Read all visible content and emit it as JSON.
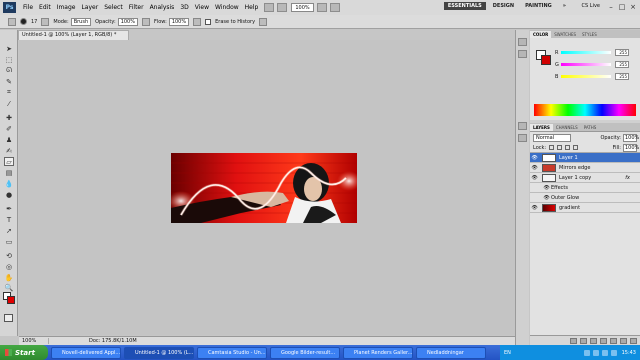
{
  "menubar": {
    "items": [
      "File",
      "Edit",
      "Image",
      "Layer",
      "Select",
      "Filter",
      "Analysis",
      "3D",
      "View",
      "Window",
      "Help"
    ],
    "zoom": "100%",
    "workspaces": [
      "ESSENTIALS",
      "DESIGN",
      "PAINTING"
    ],
    "more": "»",
    "cs_live": "CS Live",
    "window_controls": [
      "–",
      "□",
      "×"
    ]
  },
  "options_bar": {
    "brush_size": "17",
    "mode_label": "Mode:",
    "mode_value": "Brush",
    "opacity_label": "Opacity:",
    "opacity_value": "100%",
    "flow_label": "Flow:",
    "flow_value": "100%",
    "erase_history": "Erase to History"
  },
  "document": {
    "tab_title": "Untitled-1 @ 100% (Layer 1, RGB/8) *",
    "status_zoom": "100%",
    "status_doc": "Doc: 175.8K/1.10M"
  },
  "color_panel": {
    "tabs": [
      "COLOR",
      "SWATCHES",
      "STYLES"
    ],
    "channels": [
      {
        "label": "R",
        "value": "255",
        "gradient": "linear-gradient(90deg,#00ffff,#ffffff)"
      },
      {
        "label": "G",
        "value": "255",
        "gradient": "linear-gradient(90deg,#ff00ff,#ffffff)"
      },
      {
        "label": "B",
        "value": "255",
        "gradient": "linear-gradient(90deg,#ffff00,#ffffff)"
      }
    ]
  },
  "layers_panel": {
    "tabs": [
      "LAYERS",
      "CHANNELS",
      "PATHS"
    ],
    "blend_mode": "Normal",
    "opacity_label": "Opacity:",
    "opacity_value": "100%",
    "lock_label": "Lock:",
    "fill_label": "Fill:",
    "fill_value": "100%",
    "layers": [
      {
        "name": "Layer 1",
        "selected": true,
        "thumb": "#ffffff"
      },
      {
        "name": "Mirrors edge",
        "selected": false,
        "thumb": "#c83a2a"
      },
      {
        "name": "Layer 1 copy",
        "selected": false,
        "thumb": "#f5f5f5",
        "fx": "fx"
      },
      {
        "name": "Effects",
        "selected": false,
        "sub": true
      },
      {
        "name": "Outer Glow",
        "selected": false,
        "sub": true
      },
      {
        "name": "gradient",
        "selected": false,
        "thumb": "#b50000"
      }
    ]
  },
  "taskbar": {
    "start": "Start",
    "tasks": [
      {
        "label": "Novell-delivered Appl...",
        "active": false
      },
      {
        "label": "Untitled-1 @ 100% (L...",
        "active": true
      },
      {
        "label": "Camtasia Studio - Un...",
        "active": false
      },
      {
        "label": "Google Bilder-result...",
        "active": false
      },
      {
        "label": "Planet Renders Galler...",
        "active": false
      },
      {
        "label": "Nedladdningar",
        "active": false
      }
    ],
    "lang": "EN",
    "time": "15:43"
  },
  "colors": {
    "accent_red": "#e00000",
    "selection_blue": "#3a6fc7",
    "taskbar_blue": "#2453c4"
  }
}
